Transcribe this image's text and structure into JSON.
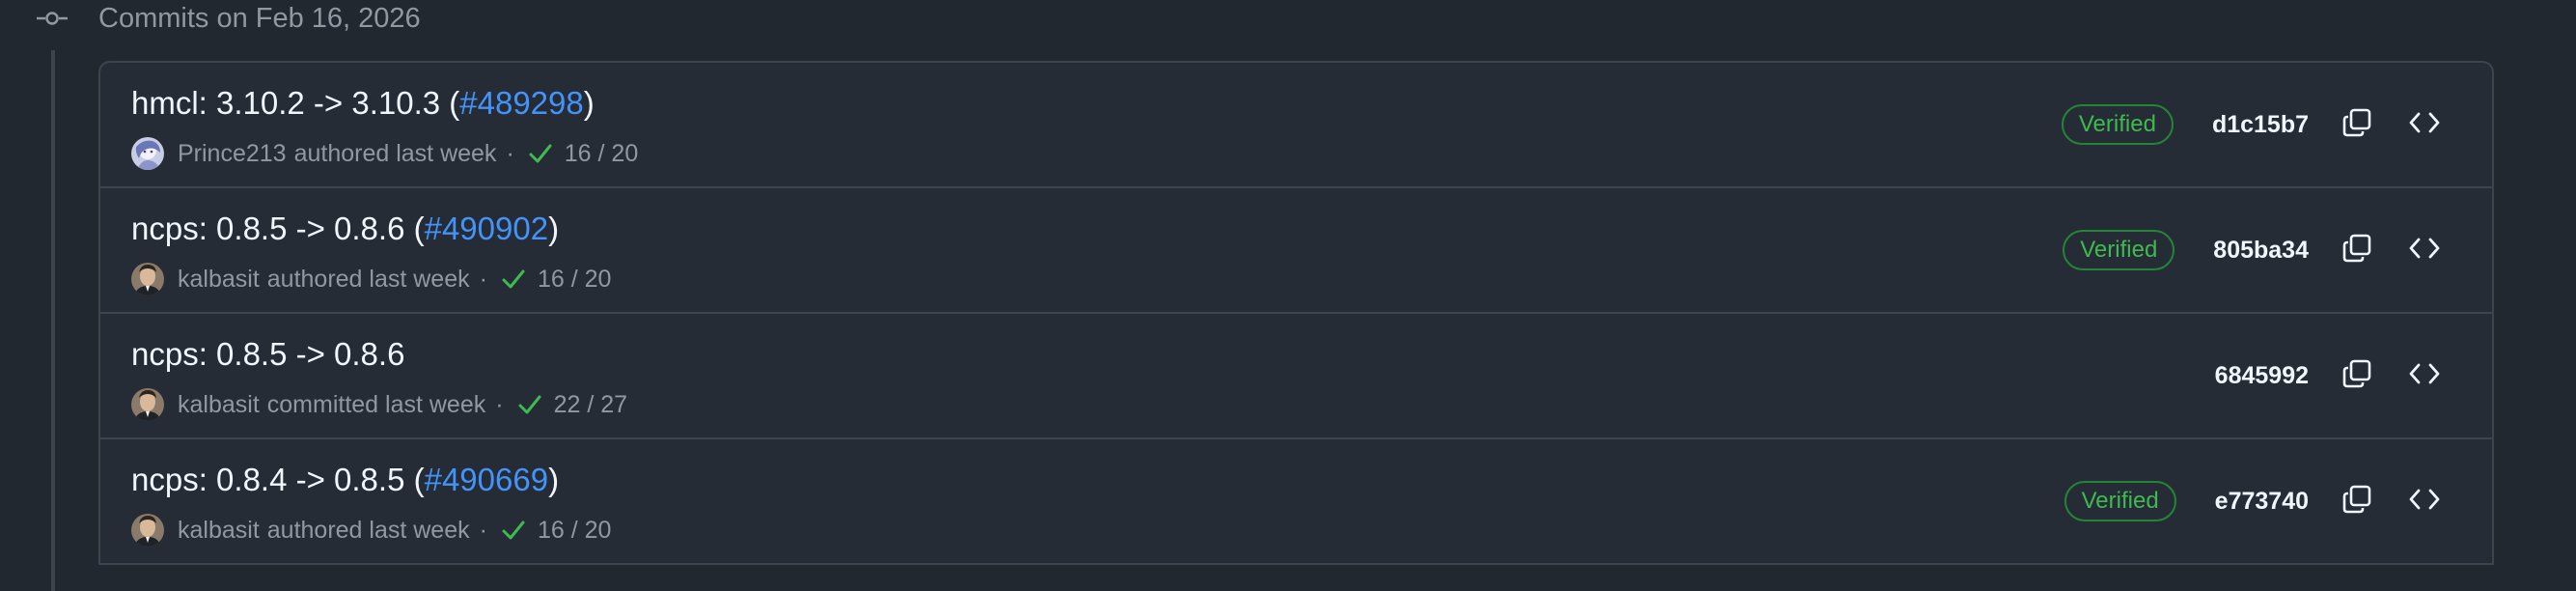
{
  "date_header": {
    "label": "Commits on Feb 16, 2026"
  },
  "colors": {
    "background": "#212830",
    "row_background": "#262c36",
    "border": "#3d444d",
    "link": "#4493f8",
    "verified": "#3fb950",
    "muted_text": "#9198a1"
  },
  "commits": [
    {
      "title_prefix": "hmcl: 3.10.2 -> 3.10.3 (",
      "pr": "#489298",
      "title_suffix": ")",
      "author": "Prince213",
      "action": "authored last week",
      "separator": "·",
      "checks": "16 / 20",
      "verified": "Verified",
      "sha": "d1c15b7",
      "avatar_icon": "prince213-avatar"
    },
    {
      "title_prefix": "ncps: 0.8.5 -> 0.8.6 (",
      "pr": "#490902",
      "title_suffix": ")",
      "author": "kalbasit",
      "action": "authored last week",
      "separator": "·",
      "checks": "16 / 20",
      "verified": "Verified",
      "sha": "805ba34",
      "avatar_icon": "kalbasit-avatar"
    },
    {
      "title_prefix": "ncps: 0.8.5 -> 0.8.6",
      "pr": "",
      "title_suffix": "",
      "author": "kalbasit",
      "action": "committed last week",
      "separator": "·",
      "checks": "22 / 27",
      "verified": "",
      "sha": "6845992",
      "avatar_icon": "kalbasit-avatar"
    },
    {
      "title_prefix": "ncps: 0.8.4 -> 0.8.5 (",
      "pr": "#490669",
      "title_suffix": ")",
      "author": "kalbasit",
      "action": "authored last week",
      "separator": "·",
      "checks": "16 / 20",
      "verified": "Verified",
      "sha": "e773740",
      "avatar_icon": "kalbasit-avatar"
    }
  ]
}
